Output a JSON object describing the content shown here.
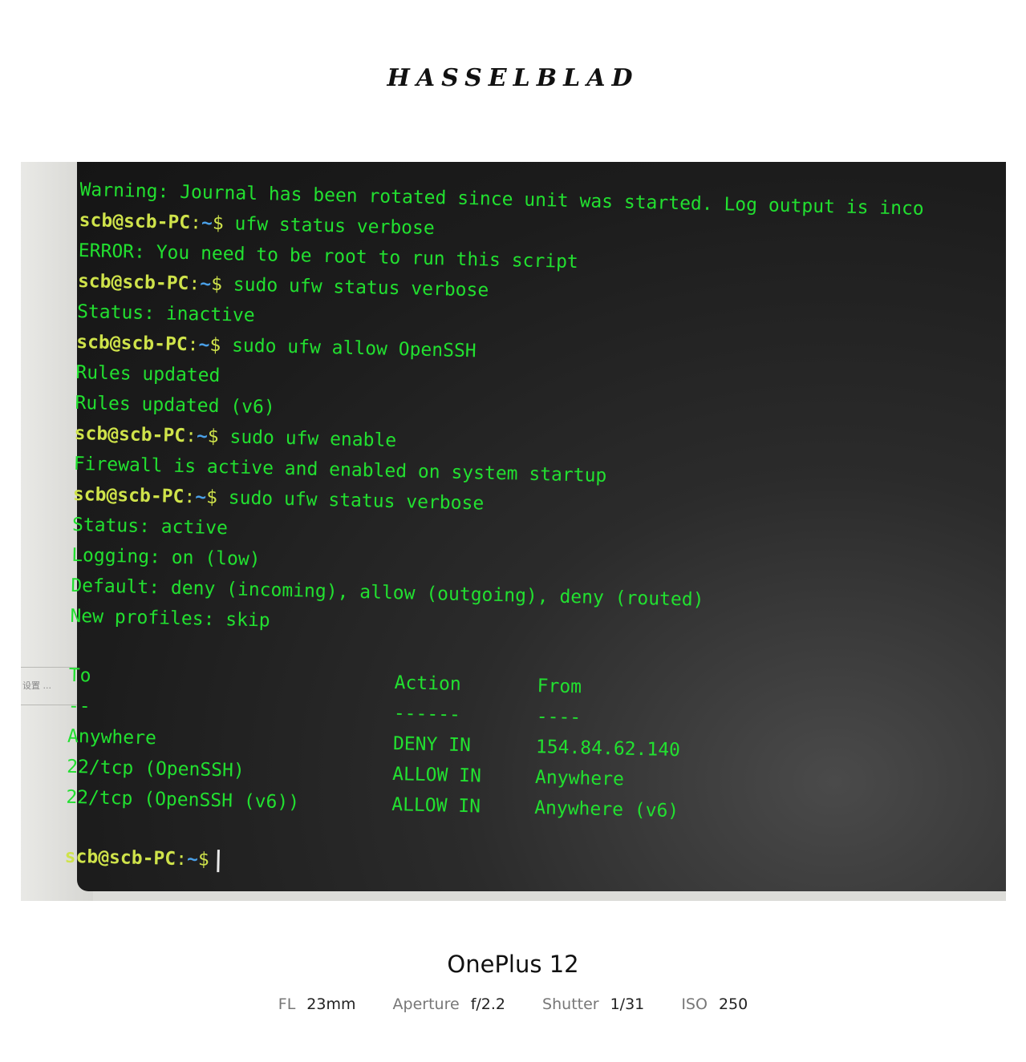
{
  "brand": "HASSELBLAD",
  "wall_label": "设置 ...",
  "terminal": {
    "prompt": {
      "user": "scb@scb-PC",
      "colon": ":",
      "path": "~",
      "dollar": "$"
    },
    "lines": [
      {
        "type": "out",
        "text": "Warning: Journal has been rotated since unit was started. Log output is inco"
      },
      {
        "type": "cmd",
        "text": "ufw status verbose"
      },
      {
        "type": "out",
        "text": "ERROR: You need to be root to run this script"
      },
      {
        "type": "cmd",
        "text": "sudo ufw status verbose"
      },
      {
        "type": "out",
        "text": "Status: inactive"
      },
      {
        "type": "cmd",
        "text": "sudo ufw allow OpenSSH"
      },
      {
        "type": "out",
        "text": "Rules updated"
      },
      {
        "type": "out",
        "text": "Rules updated (v6)"
      },
      {
        "type": "cmd",
        "text": "sudo ufw enable"
      },
      {
        "type": "out",
        "text": "Firewall is active and enabled on system startup"
      },
      {
        "type": "cmd",
        "text": "sudo ufw status verbose"
      },
      {
        "type": "out",
        "text": "Status: active"
      },
      {
        "type": "out",
        "text": "Logging: on (low)"
      },
      {
        "type": "out",
        "text": "Default: deny (incoming), allow (outgoing), deny (routed)"
      },
      {
        "type": "out",
        "text": "New profiles: skip"
      }
    ],
    "table": {
      "headers": [
        "To",
        "Action",
        "From"
      ],
      "separators": [
        "--",
        "------",
        "----"
      ],
      "rows": [
        [
          "Anywhere",
          "DENY IN",
          "154.84.62.140"
        ],
        [
          "22/tcp (OpenSSH)",
          "ALLOW IN",
          "Anywhere"
        ],
        [
          "22/tcp (OpenSSH (v6))",
          "ALLOW IN",
          "Anywhere (v6)"
        ]
      ]
    }
  },
  "caption": {
    "device": "OnePlus 12",
    "specs": [
      {
        "label": "FL",
        "value": "23mm"
      },
      {
        "label": "Aperture",
        "value": "f/2.2"
      },
      {
        "label": "Shutter",
        "value": "1/31"
      },
      {
        "label": "ISO",
        "value": "250"
      }
    ]
  },
  "colors": {
    "terminal_text": "#22e030",
    "prompt_user": "#cfe34a",
    "prompt_path": "#4aa0e8",
    "terminal_bg": "#1c1c1c"
  }
}
